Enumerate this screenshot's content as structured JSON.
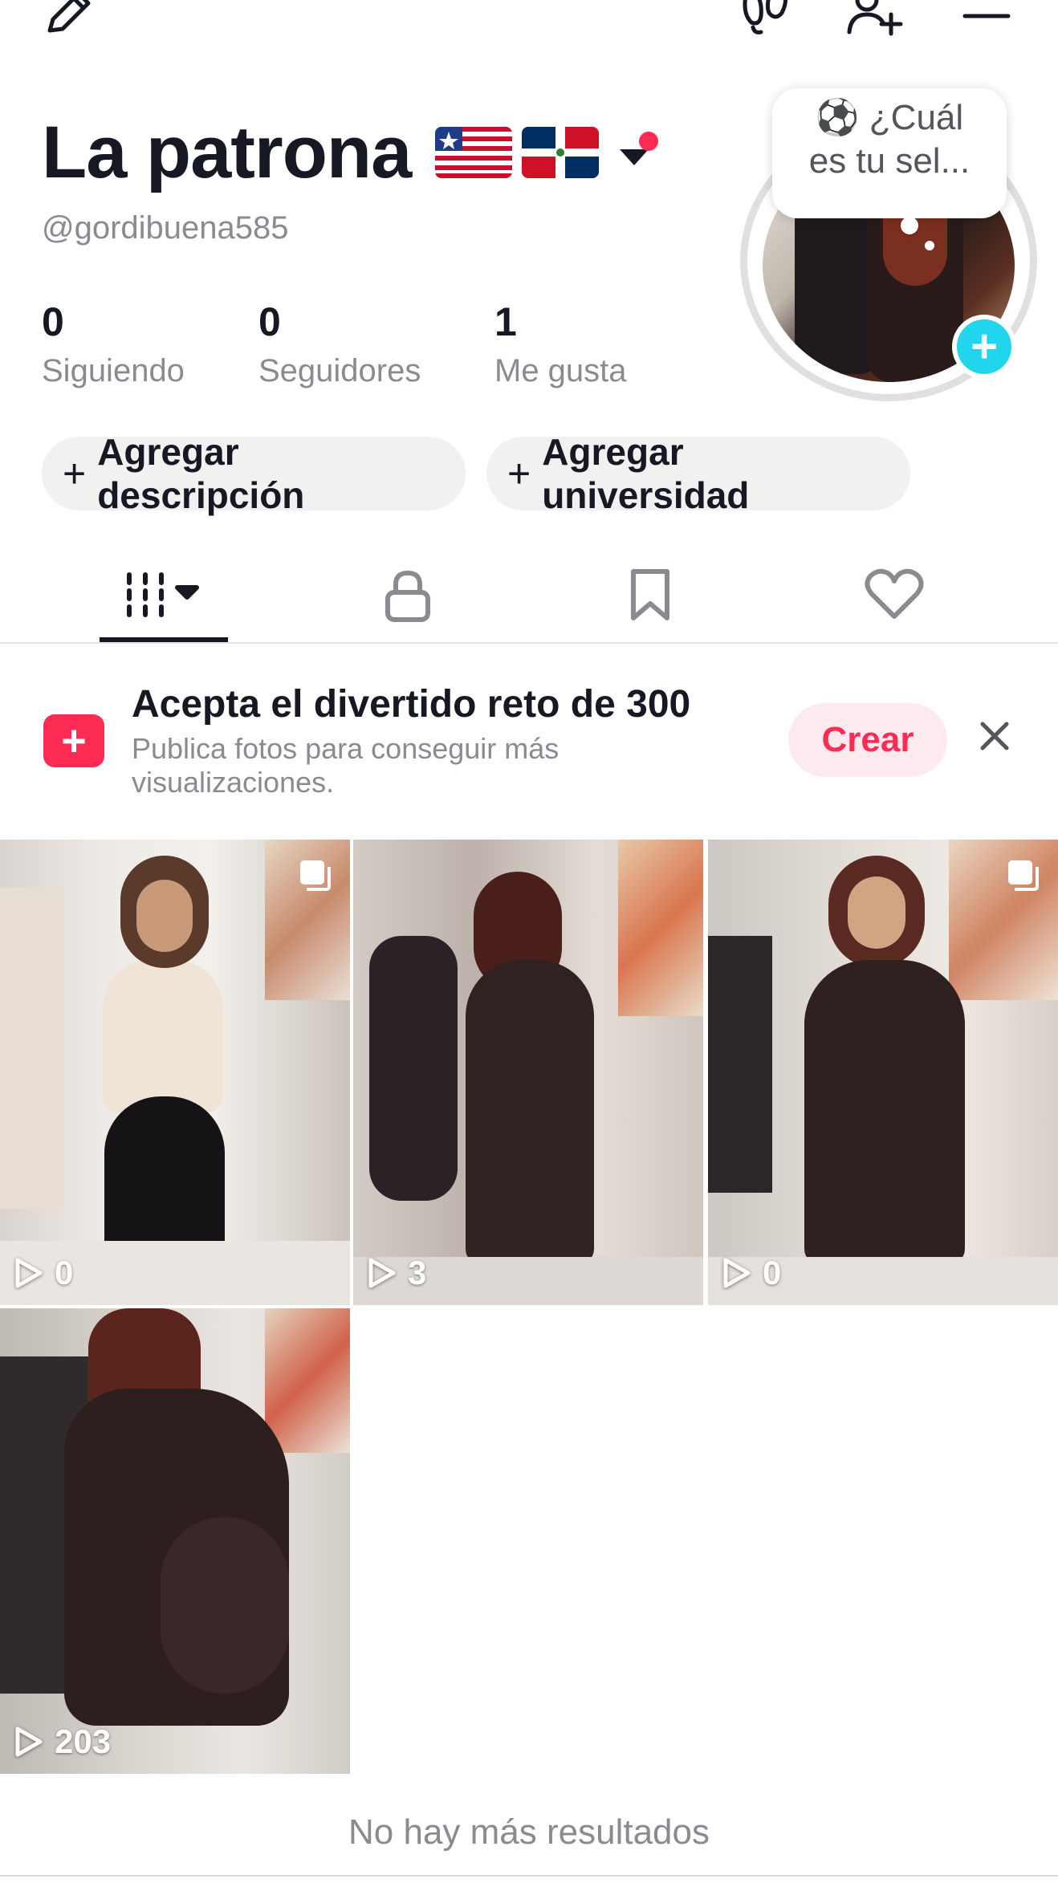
{
  "header": {
    "display_name": "La patrona",
    "username": "@gordibuena585"
  },
  "stats": [
    {
      "value": "0",
      "label": "Siguiendo"
    },
    {
      "value": "0",
      "label": "Seguidores"
    },
    {
      "value": "1",
      "label": "Me gusta"
    }
  ],
  "avatar_bubble": "⚽ ¿Cuál es tu sel...",
  "actions": {
    "add_description": "Agregar descripción",
    "add_university": "Agregar universidad"
  },
  "banner": {
    "title": "Acepta el divertido reto de 300",
    "subtitle": "Publica fotos para conseguir más visualizaciones.",
    "button": "Crear"
  },
  "videos": [
    {
      "views": "0",
      "multi_photo": true
    },
    {
      "views": "3",
      "multi_photo": false
    },
    {
      "views": "0",
      "multi_photo": true
    },
    {
      "views": "203",
      "multi_photo": false
    }
  ],
  "footer": {
    "no_more": "No hay más resultados"
  },
  "colors": {
    "accent": "#fe2c55",
    "add_avatar": "#20d5ec",
    "muted_text": "#8a8b91"
  },
  "icons": [
    "edit-icon",
    "footprints-icon",
    "add-friend-icon",
    "menu-icon",
    "grid-icon",
    "lock-icon",
    "bookmark-icon",
    "heart-icon",
    "play-icon",
    "close-icon",
    "multi-photo-icon"
  ]
}
